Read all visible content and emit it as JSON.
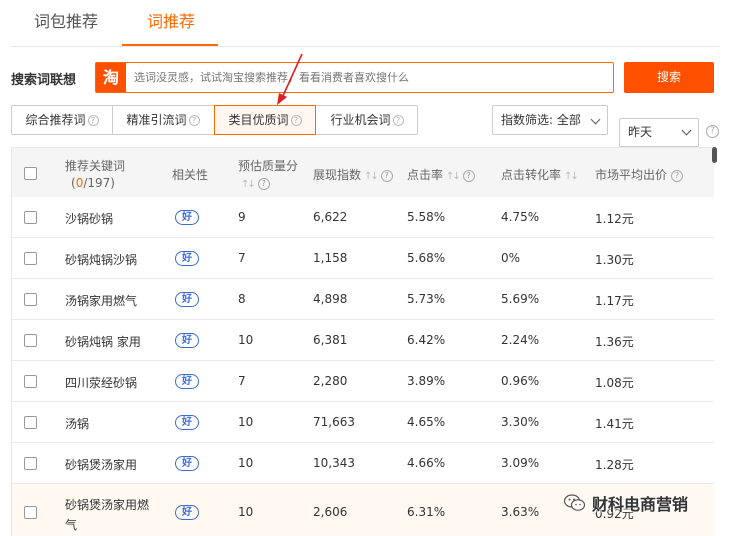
{
  "top_tabs": [
    {
      "label": "词包推荐"
    },
    {
      "label": "词推荐"
    }
  ],
  "search": {
    "label": "搜索词联想",
    "logo": "淘",
    "placeholder": "选词没灵感，试试淘宝搜索推荐，看看消费者喜欢搜什么",
    "button": "搜索"
  },
  "filter_tabs": [
    {
      "label": "综合推荐词"
    },
    {
      "label": "精准引流词"
    },
    {
      "label": "类目优质词"
    },
    {
      "label": "行业机会词"
    }
  ],
  "index_filter": "指数筛选: 全部",
  "date_select": "昨天",
  "table": {
    "headers": {
      "keyword": "推荐关键词",
      "count_selected": "0",
      "count_total": "/197",
      "relevance": "相关性",
      "quality": "预估质量分",
      "impressions": "展现指数",
      "ctr": "点击率",
      "cvr": "点击转化率",
      "avg_bid": "市场平均出价"
    },
    "good_label": "好",
    "rows": [
      {
        "keyword": "沙锅砂锅",
        "quality": "9",
        "impressions": "6,622",
        "ctr": "5.58%",
        "cvr": "4.75%",
        "bid": "1.12元"
      },
      {
        "keyword": "砂锅炖锅沙锅",
        "quality": "7",
        "impressions": "1,158",
        "ctr": "5.68%",
        "cvr": "0%",
        "bid": "1.30元"
      },
      {
        "keyword": "汤锅家用燃气",
        "quality": "8",
        "impressions": "4,898",
        "ctr": "5.73%",
        "cvr": "5.69%",
        "bid": "1.17元"
      },
      {
        "keyword": "砂锅炖锅 家用",
        "quality": "10",
        "impressions": "6,381",
        "ctr": "6.42%",
        "cvr": "2.24%",
        "bid": "1.36元"
      },
      {
        "keyword": "四川荥经砂锅",
        "quality": "7",
        "impressions": "2,280",
        "ctr": "3.89%",
        "cvr": "0.96%",
        "bid": "1.08元"
      },
      {
        "keyword": "汤锅",
        "quality": "10",
        "impressions": "71,663",
        "ctr": "4.65%",
        "cvr": "3.30%",
        "bid": "1.41元"
      },
      {
        "keyword": "砂锅煲汤家用",
        "quality": "10",
        "impressions": "10,343",
        "ctr": "4.66%",
        "cvr": "3.09%",
        "bid": "1.28元"
      },
      {
        "keyword": "砂锅煲汤家用燃",
        "keyword_line2": "气",
        "quality": "10",
        "impressions": "2,606",
        "ctr": "6.31%",
        "cvr": "3.63%",
        "bid": "0.92元"
      }
    ]
  },
  "watermark": "财科电商营销",
  "colors": {
    "accent": "#ff6a00",
    "good": "#3c6bd8",
    "arrow": "#e02020"
  }
}
